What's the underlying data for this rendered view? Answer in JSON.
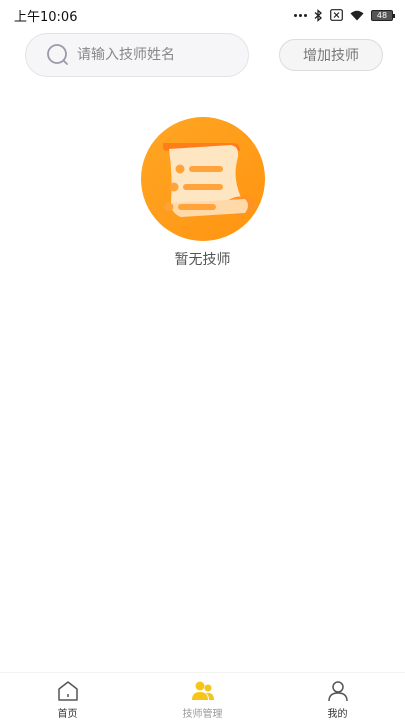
{
  "status_bar": {
    "time": "上午10:06",
    "battery": "48"
  },
  "search": {
    "placeholder": "请输入技师姓名",
    "value": ""
  },
  "add_button": {
    "label": "增加技师"
  },
  "empty_state": {
    "icon": "scroll-document-icon",
    "message": "暂无技师"
  },
  "tabbar": {
    "items": [
      {
        "label": "首页",
        "icon": "home-icon"
      },
      {
        "label": "技师管理",
        "icon": "users-icon",
        "active": true
      },
      {
        "label": "我的",
        "icon": "user-icon"
      }
    ]
  },
  "colors": {
    "accent_orange": "#FFA31A",
    "accent_yellow": "#F5C518"
  }
}
